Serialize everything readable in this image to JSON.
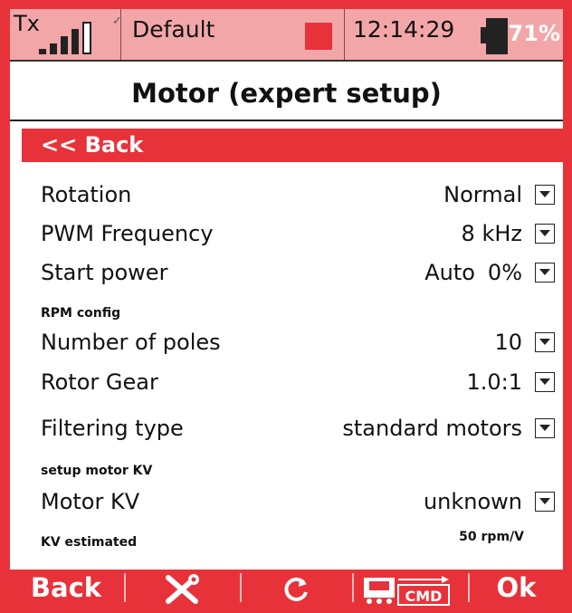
{
  "status_bar": {
    "tx_label": "Tx",
    "model_name": "Default",
    "time": "12:14:29",
    "battery_percent": "71%",
    "battery_level": 0.71
  },
  "page": {
    "title": "Motor (expert setup)",
    "back_label": "<< Back"
  },
  "settings": {
    "rotation": {
      "label": "Rotation",
      "value": "Normal"
    },
    "pwm_frequency": {
      "label": "PWM Frequency",
      "value": "8 kHz"
    },
    "start_power": {
      "label": "Start power",
      "mode": "Auto",
      "value": "0%"
    },
    "rpm_config_label": "RPM config",
    "number_of_poles": {
      "label": "Number of poles",
      "value": "10"
    },
    "rotor_gear": {
      "label": "Rotor Gear",
      "value": "1.0:1"
    },
    "filtering_type": {
      "label": "Filtering type",
      "value": "standard motors"
    },
    "setup_motor_kv_label": "setup motor KV",
    "motor_kv": {
      "label": "Motor KV",
      "value": "unknown"
    },
    "kv_estimated": {
      "label": "KV estimated",
      "value": "50 rpm/V"
    }
  },
  "bottom_bar": {
    "back": "Back",
    "cmd": "CMD",
    "ok": "Ok"
  },
  "colors": {
    "accent": "#e8323a",
    "status_bg": "#f3a6a8"
  }
}
